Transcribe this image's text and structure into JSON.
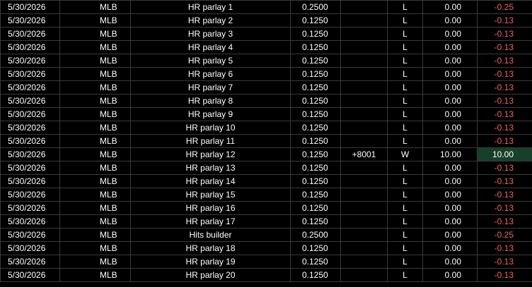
{
  "table": {
    "rows": [
      {
        "date": "5/30/2026",
        "sport": "MLB",
        "description": "HR parlay 1",
        "stake": "0.2500",
        "odds": "",
        "result": "L",
        "payout": "0.00",
        "net": "-0.25",
        "outcome": "loss"
      },
      {
        "date": "5/30/2026",
        "sport": "MLB",
        "description": "HR parlay 2",
        "stake": "0.1250",
        "odds": "",
        "result": "L",
        "payout": "0.00",
        "net": "-0.13",
        "outcome": "loss"
      },
      {
        "date": "5/30/2026",
        "sport": "MLB",
        "description": "HR parlay 3",
        "stake": "0.1250",
        "odds": "",
        "result": "L",
        "payout": "0.00",
        "net": "-0.13",
        "outcome": "loss"
      },
      {
        "date": "5/30/2026",
        "sport": "MLB",
        "description": "HR parlay 4",
        "stake": "0.1250",
        "odds": "",
        "result": "L",
        "payout": "0.00",
        "net": "-0.13",
        "outcome": "loss"
      },
      {
        "date": "5/30/2026",
        "sport": "MLB",
        "description": "HR parlay 5",
        "stake": "0.1250",
        "odds": "",
        "result": "L",
        "payout": "0.00",
        "net": "-0.13",
        "outcome": "loss"
      },
      {
        "date": "5/30/2026",
        "sport": "MLB",
        "description": "HR parlay 6",
        "stake": "0.1250",
        "odds": "",
        "result": "L",
        "payout": "0.00",
        "net": "-0.13",
        "outcome": "loss"
      },
      {
        "date": "5/30/2026",
        "sport": "MLB",
        "description": "HR parlay 7",
        "stake": "0.1250",
        "odds": "",
        "result": "L",
        "payout": "0.00",
        "net": "-0.13",
        "outcome": "loss"
      },
      {
        "date": "5/30/2026",
        "sport": "MLB",
        "description": "HR parlay 8",
        "stake": "0.1250",
        "odds": "",
        "result": "L",
        "payout": "0.00",
        "net": "-0.13",
        "outcome": "loss"
      },
      {
        "date": "5/30/2026",
        "sport": "MLB",
        "description": "HR parlay 9",
        "stake": "0.1250",
        "odds": "",
        "result": "L",
        "payout": "0.00",
        "net": "-0.13",
        "outcome": "loss"
      },
      {
        "date": "5/30/2026",
        "sport": "MLB",
        "description": "HR parlay 10",
        "stake": "0.1250",
        "odds": "",
        "result": "L",
        "payout": "0.00",
        "net": "-0.13",
        "outcome": "loss"
      },
      {
        "date": "5/30/2026",
        "sport": "MLB",
        "description": "HR parlay 11",
        "stake": "0.1250",
        "odds": "",
        "result": "L",
        "payout": "0.00",
        "net": "-0.13",
        "outcome": "loss"
      },
      {
        "date": "5/30/2026",
        "sport": "MLB",
        "description": "HR parlay 12",
        "stake": "0.1250",
        "odds": "+8001",
        "result": "W",
        "payout": "10.00",
        "net": "10.00",
        "outcome": "win"
      },
      {
        "date": "5/30/2026",
        "sport": "MLB",
        "description": "HR parlay 13",
        "stake": "0.1250",
        "odds": "",
        "result": "L",
        "payout": "0.00",
        "net": "-0.13",
        "outcome": "loss"
      },
      {
        "date": "5/30/2026",
        "sport": "MLB",
        "description": "HR parlay 14",
        "stake": "0.1250",
        "odds": "",
        "result": "L",
        "payout": "0.00",
        "net": "-0.13",
        "outcome": "loss"
      },
      {
        "date": "5/30/2026",
        "sport": "MLB",
        "description": "HR parlay 15",
        "stake": "0.1250",
        "odds": "",
        "result": "L",
        "payout": "0.00",
        "net": "-0.13",
        "outcome": "loss"
      },
      {
        "date": "5/30/2026",
        "sport": "MLB",
        "description": "HR parlay 16",
        "stake": "0.1250",
        "odds": "",
        "result": "L",
        "payout": "0.00",
        "net": "-0.13",
        "outcome": "loss"
      },
      {
        "date": "5/30/2026",
        "sport": "MLB",
        "description": "HR parlay 17",
        "stake": "0.1250",
        "odds": "",
        "result": "L",
        "payout": "0.00",
        "net": "-0.13",
        "outcome": "loss"
      },
      {
        "date": "5/30/2026",
        "sport": "MLB",
        "description": "Hits builder",
        "stake": "0.2500",
        "odds": "",
        "result": "L",
        "payout": "0.00",
        "net": "-0.25",
        "outcome": "loss"
      },
      {
        "date": "5/30/2026",
        "sport": "MLB",
        "description": "HR parlay 18",
        "stake": "0.1250",
        "odds": "",
        "result": "L",
        "payout": "0.00",
        "net": "-0.13",
        "outcome": "loss"
      },
      {
        "date": "5/30/2026",
        "sport": "MLB",
        "description": "HR parlay 19",
        "stake": "0.1250",
        "odds": "",
        "result": "L",
        "payout": "0.00",
        "net": "-0.13",
        "outcome": "loss"
      },
      {
        "date": "5/30/2026",
        "sport": "MLB",
        "description": "HR parlay 20",
        "stake": "0.1250",
        "odds": "",
        "result": "L",
        "payout": "0.00",
        "net": "-0.13",
        "outcome": "loss"
      }
    ]
  },
  "colors": {
    "background": "#000000",
    "grid": "#3a3a3a",
    "text": "#ffffff",
    "loss_text": "#f06464",
    "win_fill": "#17402a"
  }
}
